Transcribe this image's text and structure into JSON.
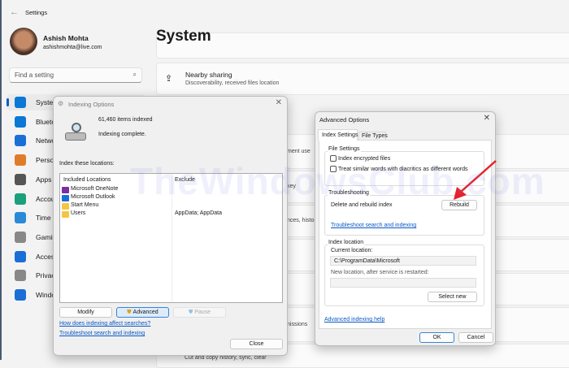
{
  "settings": {
    "title": "Settings",
    "user_name": "Ashish Mohta",
    "user_email": "ashishmohta@live.com",
    "search_placeholder": "Find a setting",
    "page_title": "System",
    "nav": [
      {
        "label": "System",
        "color": "#0a78d4"
      },
      {
        "label": "Bluetooth & devices",
        "color": "#0a78d4"
      },
      {
        "label": "Network & internet",
        "color": "#1a6fd6"
      },
      {
        "label": "Personalization",
        "color": "#e07b2a"
      },
      {
        "label": "Apps",
        "color": "#555"
      },
      {
        "label": "Accounts",
        "color": "#1aa07a"
      },
      {
        "label": "Time & language",
        "color": "#2a8ad6"
      },
      {
        "label": "Gaming",
        "color": "#888"
      },
      {
        "label": "Accessibility",
        "color": "#1a6fd6"
      },
      {
        "label": "Privacy & security",
        "color": "#888"
      },
      {
        "label": "Windows Update",
        "color": "#1a6fd6"
      }
    ],
    "cards": [
      {
        "title": "Nearby sharing",
        "subtitle": "Discoverability, received files location"
      }
    ],
    "partial_texts": [
      "ment use",
      "key",
      "nces, histo",
      "nissions",
      "Cut and copy history, sync, clear"
    ]
  },
  "indexing": {
    "title": "Indexing Options",
    "count": "61,460 items indexed",
    "status": "Indexing complete.",
    "locations_label": "Index these locations:",
    "col_included": "Included Locations",
    "col_exclude": "Exclude",
    "rows": [
      {
        "name": "Microsoft OneNote",
        "exclude": "",
        "icon": "onenote-icon"
      },
      {
        "name": "Microsoft Outlook",
        "exclude": "",
        "icon": "outlook-icon"
      },
      {
        "name": "Start Menu",
        "exclude": "",
        "icon": "folder-icon"
      },
      {
        "name": "Users",
        "exclude": "AppData; AppData",
        "icon": "folder-icon"
      }
    ],
    "modify": "Modify",
    "advanced": "Advanced",
    "pause": "Pause",
    "link1": "How does indexing affect searches?",
    "link2": "Troubleshoot search and indexing",
    "close": "Close"
  },
  "advanced": {
    "title": "Advanced Options",
    "tab1": "Index Settings",
    "tab2": "File Types",
    "file_settings": "File Settings",
    "cb1": "Index encrypted files",
    "cb2": "Treat similar words with diacritics as different words",
    "troubleshooting": "Troubleshooting",
    "rebuild_label": "Delete and rebuild index",
    "rebuild": "Rebuild",
    "troubleshoot_link": "Troubleshoot search and indexing",
    "index_location": "Index location",
    "current_label": "Current location:",
    "current_value": "C:\\ProgramData\\Microsoft",
    "new_label": "New location, after service is restarted:",
    "new_value": "",
    "select_new": "Select new",
    "help_link": "Advanced indexing help",
    "ok": "OK",
    "cancel": "Cancel"
  },
  "watermark": "TheWindowsClub.com"
}
